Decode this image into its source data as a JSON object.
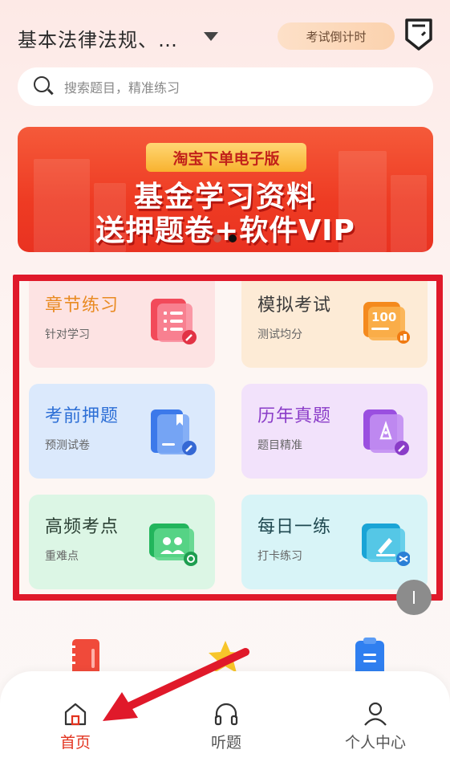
{
  "header": {
    "subject": "基本法律法规、…",
    "countdown_label": "考试倒计时"
  },
  "search": {
    "placeholder": "搜索题目，精准练习"
  },
  "banner": {
    "tag": "淘宝下单电子版",
    "line1": "基金学习资料",
    "line2": "送押题卷+软件VIP",
    "page_count": 2,
    "active_page": 2
  },
  "grid": {
    "cards": [
      {
        "title": "章节练习",
        "subtitle": "针对学习",
        "icon": "chapter-practice-icon"
      },
      {
        "title": "模拟考试",
        "subtitle": "测试均分",
        "icon": "mock-exam-icon",
        "icon_text": "100"
      },
      {
        "title": "考前押题",
        "subtitle": "预测试卷",
        "icon": "pre-exam-icon"
      },
      {
        "title": "历年真题",
        "subtitle": "题目精准",
        "icon": "past-papers-icon"
      },
      {
        "title": "高频考点",
        "subtitle": "重难点",
        "icon": "key-points-icon"
      },
      {
        "title": "每日一练",
        "subtitle": "打卡练习",
        "icon": "daily-practice-icon"
      }
    ]
  },
  "tabbar": {
    "items": [
      {
        "label": "首页",
        "icon": "home-icon",
        "active": true
      },
      {
        "label": "听题",
        "icon": "headphones-icon",
        "active": false
      },
      {
        "label": "个人中心",
        "icon": "person-icon",
        "active": false
      }
    ]
  },
  "colors": {
    "accent": "#e2331f",
    "highlight_frame": "#e0192a",
    "banner_red": "#ee3b23",
    "countdown_bg": "#fbd2ae"
  }
}
